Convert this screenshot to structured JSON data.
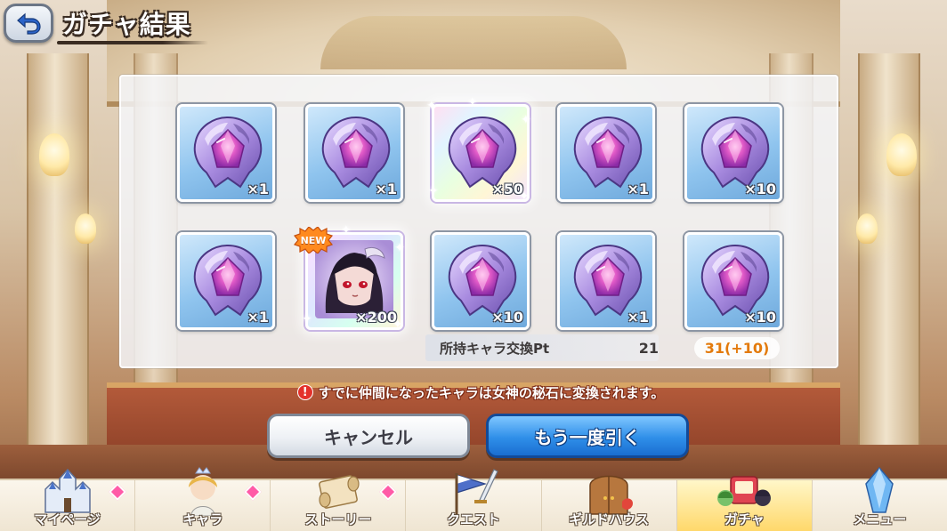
{
  "header": {
    "back_icon": "back-arrow-icon",
    "title": "ガチャ結果"
  },
  "results": [
    {
      "type": "goddess-stone",
      "quantity": "×1",
      "frame": "normal"
    },
    {
      "type": "goddess-stone",
      "quantity": "×1",
      "frame": "normal"
    },
    {
      "type": "goddess-stone",
      "quantity": "×50",
      "frame": "rainbow"
    },
    {
      "type": "goddess-stone",
      "quantity": "×1",
      "frame": "normal"
    },
    {
      "type": "goddess-stone",
      "quantity": "×10",
      "frame": "normal"
    },
    {
      "type": "goddess-stone",
      "quantity": "×1",
      "frame": "normal"
    },
    {
      "type": "character",
      "quantity": "×200",
      "frame": "rainbow",
      "badge": "NEW"
    },
    {
      "type": "goddess-stone",
      "quantity": "×10",
      "frame": "normal"
    },
    {
      "type": "goddess-stone",
      "quantity": "×1",
      "frame": "normal"
    },
    {
      "type": "goddess-stone",
      "quantity": "×10",
      "frame": "normal"
    }
  ],
  "exchange": {
    "label": "所持キャラ交換Pt",
    "before": "21",
    "after": "31(+10)"
  },
  "notice": {
    "icon": "!",
    "text": "すでに仲間になったキャラは女神の秘石に変換されます。"
  },
  "buttons": {
    "cancel": "キャンセル",
    "redraw": "もう一度引く"
  },
  "nav": {
    "items": [
      {
        "label": "マイページ",
        "icon": "castle-icon",
        "badge": true,
        "active": false
      },
      {
        "label": "キャラ",
        "icon": "character-icon",
        "badge": true,
        "active": false
      },
      {
        "label": "ストーリー",
        "icon": "scroll-icon",
        "badge": true,
        "active": false
      },
      {
        "label": "クエスト",
        "icon": "sword-flag-icon",
        "badge": false,
        "active": false
      },
      {
        "label": "ギルドハウス",
        "icon": "house-door-icon",
        "badge": false,
        "active": false
      },
      {
        "label": "ガチャ",
        "icon": "gacha-icon",
        "badge": false,
        "active": true
      },
      {
        "label": "メニュー",
        "icon": "crystal-icon",
        "badge": false,
        "active": false
      }
    ]
  },
  "colors": {
    "accent_blue": "#2f8fe9",
    "points_orange": "#e37a0a",
    "badge_pink": "#ff5aa7",
    "gem_purple": "#9a6fd6"
  }
}
